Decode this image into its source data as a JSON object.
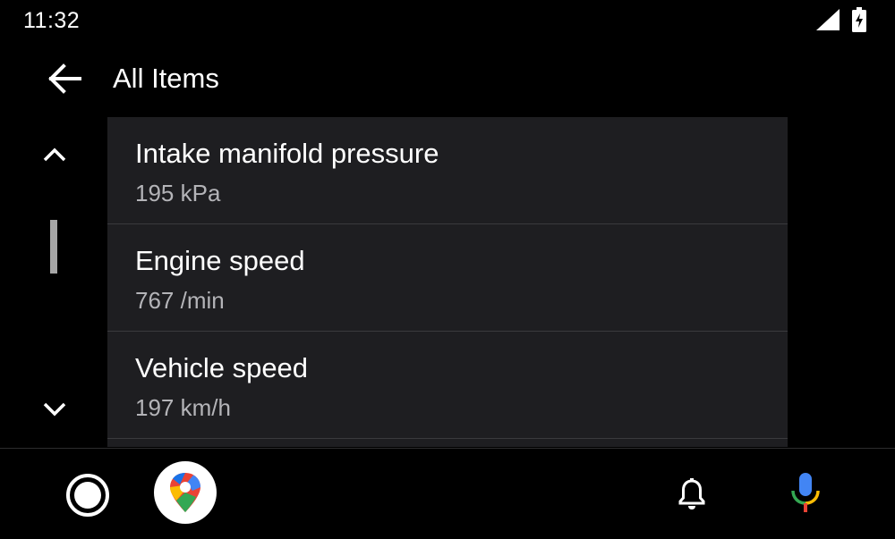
{
  "status_bar": {
    "time": "11:32",
    "icons": [
      "signal-icon",
      "battery-charging-icon"
    ]
  },
  "header": {
    "back_icon": "arrow-left-icon",
    "title": "All Items"
  },
  "scroll": {
    "up_icon": "chevron-up-icon",
    "down_icon": "chevron-down-icon"
  },
  "list": {
    "items": [
      {
        "title": "Intake manifold pressure",
        "value": "195 kPa"
      },
      {
        "title": "Engine speed",
        "value": "767 /min"
      },
      {
        "title": "Vehicle speed",
        "value": "197 km/h"
      }
    ]
  },
  "bottom_bar": {
    "home_icon": "home-circle-icon",
    "app_icon": "google-maps-icon",
    "notification_icon": "bell-icon",
    "voice_icon": "microphone-icon"
  },
  "colors": {
    "background": "#000000",
    "list_background": "#1e1e21",
    "primary_text": "#ffffff",
    "secondary_text": "#b4b4b8",
    "divider": "#3a3a3d"
  }
}
